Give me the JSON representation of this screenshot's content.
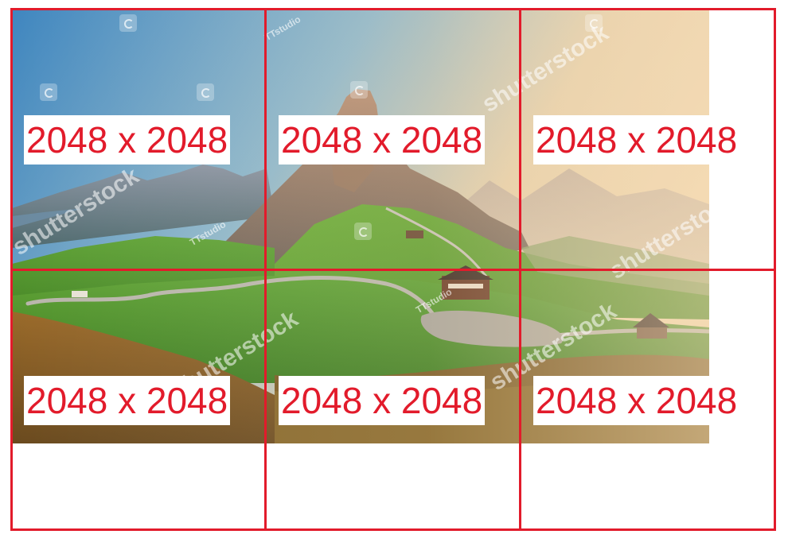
{
  "tiles": [
    {
      "label": "2048 x 2048"
    },
    {
      "label": "2048 x 2048"
    },
    {
      "label": "2048 x 2048"
    },
    {
      "label": "2048 x 2048"
    },
    {
      "label": "2048 x 2048"
    },
    {
      "label": "2048 x 2048"
    }
  ],
  "watermark": {
    "brand": "shutterstock",
    "contributor": "TTstudio"
  },
  "colors": {
    "grid": "#e21b2b",
    "label_text": "#e21b2b",
    "label_background": "#ffffff"
  }
}
